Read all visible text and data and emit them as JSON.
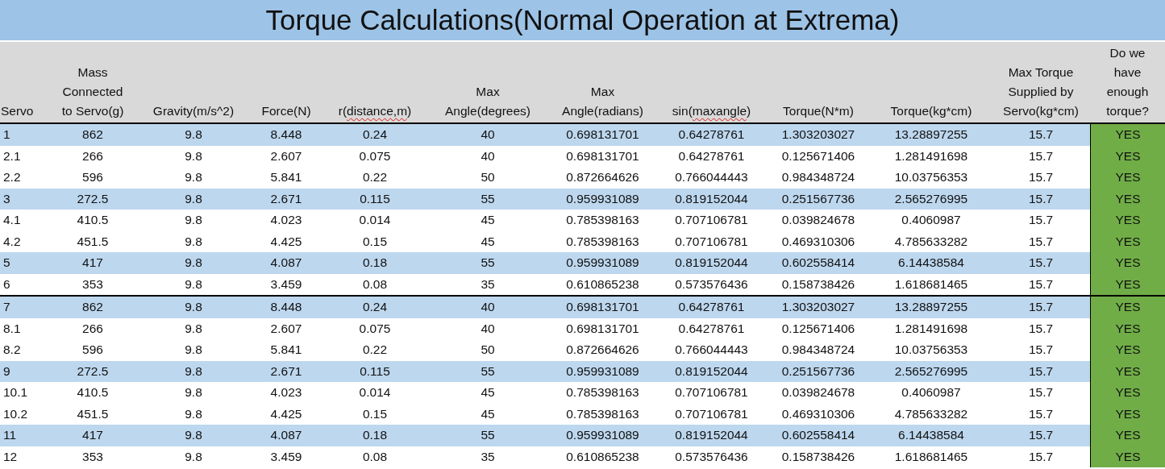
{
  "title": "Torque Calculations(Normal Operation at Extrema)",
  "columns": [
    {
      "label": "Servo",
      "spell_marked": false
    },
    {
      "label": "Mass\nConnected\nto Servo(g)",
      "spell_marked": false
    },
    {
      "label": "Gravity(m/s^2)",
      "spell_marked": false
    },
    {
      "label": "Force(N)",
      "spell_marked": false
    },
    {
      "label": "r(distance,m)",
      "spell_marked": true
    },
    {
      "label": "Max\nAngle(degrees)",
      "spell_marked": false
    },
    {
      "label": "Max\nAngle(radians)",
      "spell_marked": false
    },
    {
      "label": "sin(maxangle)",
      "spell_marked": true
    },
    {
      "label": "Torque(N*m)",
      "spell_marked": false
    },
    {
      "label": "Torque(kg*cm)",
      "spell_marked": false
    },
    {
      "label": "Max Torque\nSupplied by\nServo(kg*cm)",
      "spell_marked": false
    },
    {
      "label": "Do we\nhave\nenough\ntorque?",
      "spell_marked": false
    }
  ],
  "groups": [
    {
      "rows": [
        {
          "highlighted": true,
          "enough": true,
          "cells": [
            "1",
            "862",
            "9.8",
            "8.448",
            "0.24",
            "40",
            "0.698131701",
            "0.64278761",
            "1.303203027",
            "13.28897255",
            "15.7",
            "YES"
          ]
        },
        {
          "highlighted": false,
          "enough": true,
          "cells": [
            "2.1",
            "266",
            "9.8",
            "2.607",
            "0.075",
            "40",
            "0.698131701",
            "0.64278761",
            "0.125671406",
            "1.281491698",
            "15.7",
            "YES"
          ]
        },
        {
          "highlighted": false,
          "enough": true,
          "cells": [
            "2.2",
            "596",
            "9.8",
            "5.841",
            "0.22",
            "50",
            "0.872664626",
            "0.766044443",
            "0.984348724",
            "10.03756353",
            "15.7",
            "YES"
          ]
        },
        {
          "highlighted": true,
          "enough": true,
          "cells": [
            "3",
            "272.5",
            "9.8",
            "2.671",
            "0.115",
            "55",
            "0.959931089",
            "0.819152044",
            "0.251567736",
            "2.565276995",
            "15.7",
            "YES"
          ]
        },
        {
          "highlighted": false,
          "enough": true,
          "cells": [
            "4.1",
            "410.5",
            "9.8",
            "4.023",
            "0.014",
            "45",
            "0.785398163",
            "0.707106781",
            "0.039824678",
            "0.4060987",
            "15.7",
            "YES"
          ]
        },
        {
          "highlighted": false,
          "enough": true,
          "cells": [
            "4.2",
            "451.5",
            "9.8",
            "4.425",
            "0.15",
            "45",
            "0.785398163",
            "0.707106781",
            "0.469310306",
            "4.785633282",
            "15.7",
            "YES"
          ]
        },
        {
          "highlighted": true,
          "enough": true,
          "cells": [
            "5",
            "417",
            "9.8",
            "4.087",
            "0.18",
            "55",
            "0.959931089",
            "0.819152044",
            "0.602558414",
            "6.14438584",
            "15.7",
            "YES"
          ]
        },
        {
          "highlighted": false,
          "enough": true,
          "cells": [
            "6",
            "353",
            "9.8",
            "3.459",
            "0.08",
            "35",
            "0.610865238",
            "0.573576436",
            "0.158738426",
            "1.618681465",
            "15.7",
            "YES"
          ]
        }
      ]
    },
    {
      "rows": [
        {
          "highlighted": true,
          "enough": true,
          "cells": [
            "7",
            "862",
            "9.8",
            "8.448",
            "0.24",
            "40",
            "0.698131701",
            "0.64278761",
            "1.303203027",
            "13.28897255",
            "15.7",
            "YES"
          ]
        },
        {
          "highlighted": false,
          "enough": true,
          "cells": [
            "8.1",
            "266",
            "9.8",
            "2.607",
            "0.075",
            "40",
            "0.698131701",
            "0.64278761",
            "0.125671406",
            "1.281491698",
            "15.7",
            "YES"
          ]
        },
        {
          "highlighted": false,
          "enough": true,
          "cells": [
            "8.2",
            "596",
            "9.8",
            "5.841",
            "0.22",
            "50",
            "0.872664626",
            "0.766044443",
            "0.984348724",
            "10.03756353",
            "15.7",
            "YES"
          ]
        },
        {
          "highlighted": true,
          "enough": true,
          "cells": [
            "9",
            "272.5",
            "9.8",
            "2.671",
            "0.115",
            "55",
            "0.959931089",
            "0.819152044",
            "0.251567736",
            "2.565276995",
            "15.7",
            "YES"
          ]
        },
        {
          "highlighted": false,
          "enough": true,
          "cells": [
            "10.1",
            "410.5",
            "9.8",
            "4.023",
            "0.014",
            "45",
            "0.785398163",
            "0.707106781",
            "0.039824678",
            "0.4060987",
            "15.7",
            "YES"
          ]
        },
        {
          "highlighted": false,
          "enough": true,
          "cells": [
            "10.2",
            "451.5",
            "9.8",
            "4.425",
            "0.15",
            "45",
            "0.785398163",
            "0.707106781",
            "0.469310306",
            "4.785633282",
            "15.7",
            "YES"
          ]
        },
        {
          "highlighted": true,
          "enough": true,
          "cells": [
            "11",
            "417",
            "9.8",
            "4.087",
            "0.18",
            "55",
            "0.959931089",
            "0.819152044",
            "0.602558414",
            "6.14438584",
            "15.7",
            "YES"
          ]
        },
        {
          "highlighted": false,
          "enough": true,
          "cells": [
            "12",
            "353",
            "9.8",
            "3.459",
            "0.08",
            "35",
            "0.610865238",
            "0.573576436",
            "0.158738426",
            "1.618681465",
            "15.7",
            "YES"
          ]
        }
      ]
    }
  ]
}
